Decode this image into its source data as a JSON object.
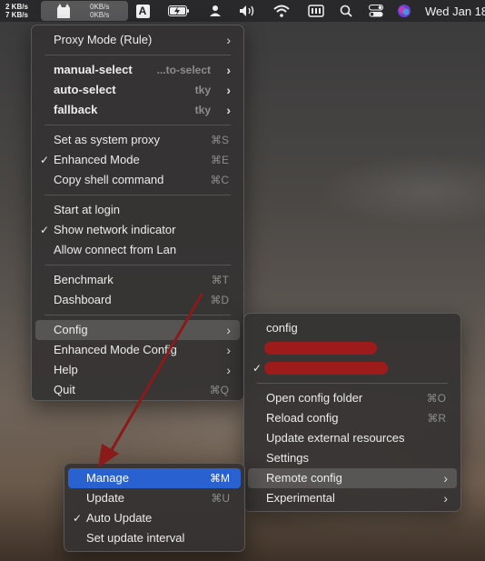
{
  "menubar": {
    "net_up": "2 KB/s",
    "net_down": "7 KB/s",
    "cat_up": "0KB/s",
    "cat_down": "0KB/s",
    "input_letter": "A",
    "clock": "Wed Jan 18"
  },
  "main_menu": {
    "proxy_mode": "Proxy Mode (Rule)",
    "manual_select": "manual-select",
    "manual_select_value": "...to-select",
    "auto_select": "auto-select",
    "auto_select_value": "tky",
    "fallback": "fallback",
    "fallback_value": "tky",
    "set_system_proxy": "Set as system proxy",
    "set_system_proxy_sc": "⌘S",
    "enhanced_mode": "Enhanced Mode",
    "enhanced_mode_sc": "⌘E",
    "copy_shell": "Copy shell command",
    "copy_shell_sc": "⌘C",
    "start_login": "Start at login",
    "show_network": "Show network indicator",
    "allow_lan": "Allow connect from Lan",
    "benchmark": "Benchmark",
    "benchmark_sc": "⌘T",
    "dashboard": "Dashboard",
    "dashboard_sc": "⌘D",
    "config": "Config",
    "enhanced_config": "Enhanced Mode Config",
    "help": "Help",
    "quit": "Quit",
    "quit_sc": "⌘Q"
  },
  "config_menu": {
    "config": "config",
    "open_folder": "Open config folder",
    "open_folder_sc": "⌘O",
    "reload": "Reload config",
    "reload_sc": "⌘R",
    "update_external": "Update external resources",
    "settings": "Settings",
    "remote_config": "Remote config",
    "experimental": "Experimental"
  },
  "remote_menu": {
    "manage": "Manage",
    "manage_sc": "⌘M",
    "update": "Update",
    "update_sc": "⌘U",
    "auto_update": "Auto Update",
    "set_interval": "Set update interval"
  },
  "colors": {
    "highlight": "#2a61d0",
    "arrow": "#8b1a1a",
    "redaction": "#9e1b1b"
  }
}
